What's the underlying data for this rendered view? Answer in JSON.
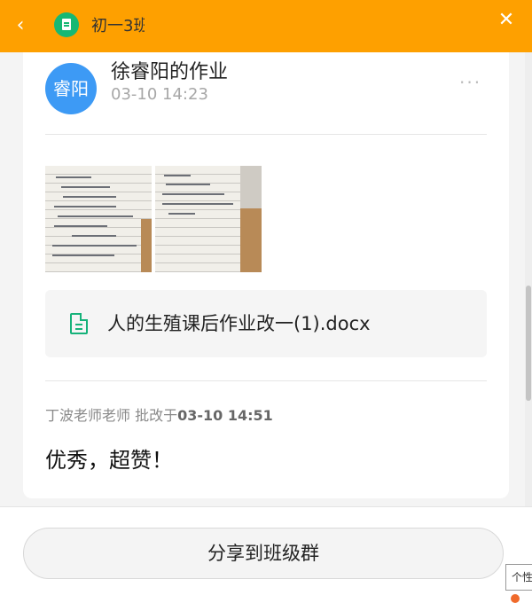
{
  "header": {
    "title": "初一3班",
    "back_icon": "‹",
    "close_icon": "✕",
    "color": "#fea000"
  },
  "post": {
    "avatar_text": "睿阳",
    "avatar_color": "#3d9af5",
    "author_title": "徐睿阳的作业",
    "time": "03-10 14:23",
    "more_icon": "···",
    "attachment_name": "人的生殖课后作业改一(1).docx"
  },
  "review": {
    "reviewer": "丁波老师老师",
    "action": " 批改于",
    "time": "03-10 14:51",
    "comment": "优秀，超赞！"
  },
  "footer": {
    "share_label": "分享到班级群",
    "tooltip": "个性"
  }
}
